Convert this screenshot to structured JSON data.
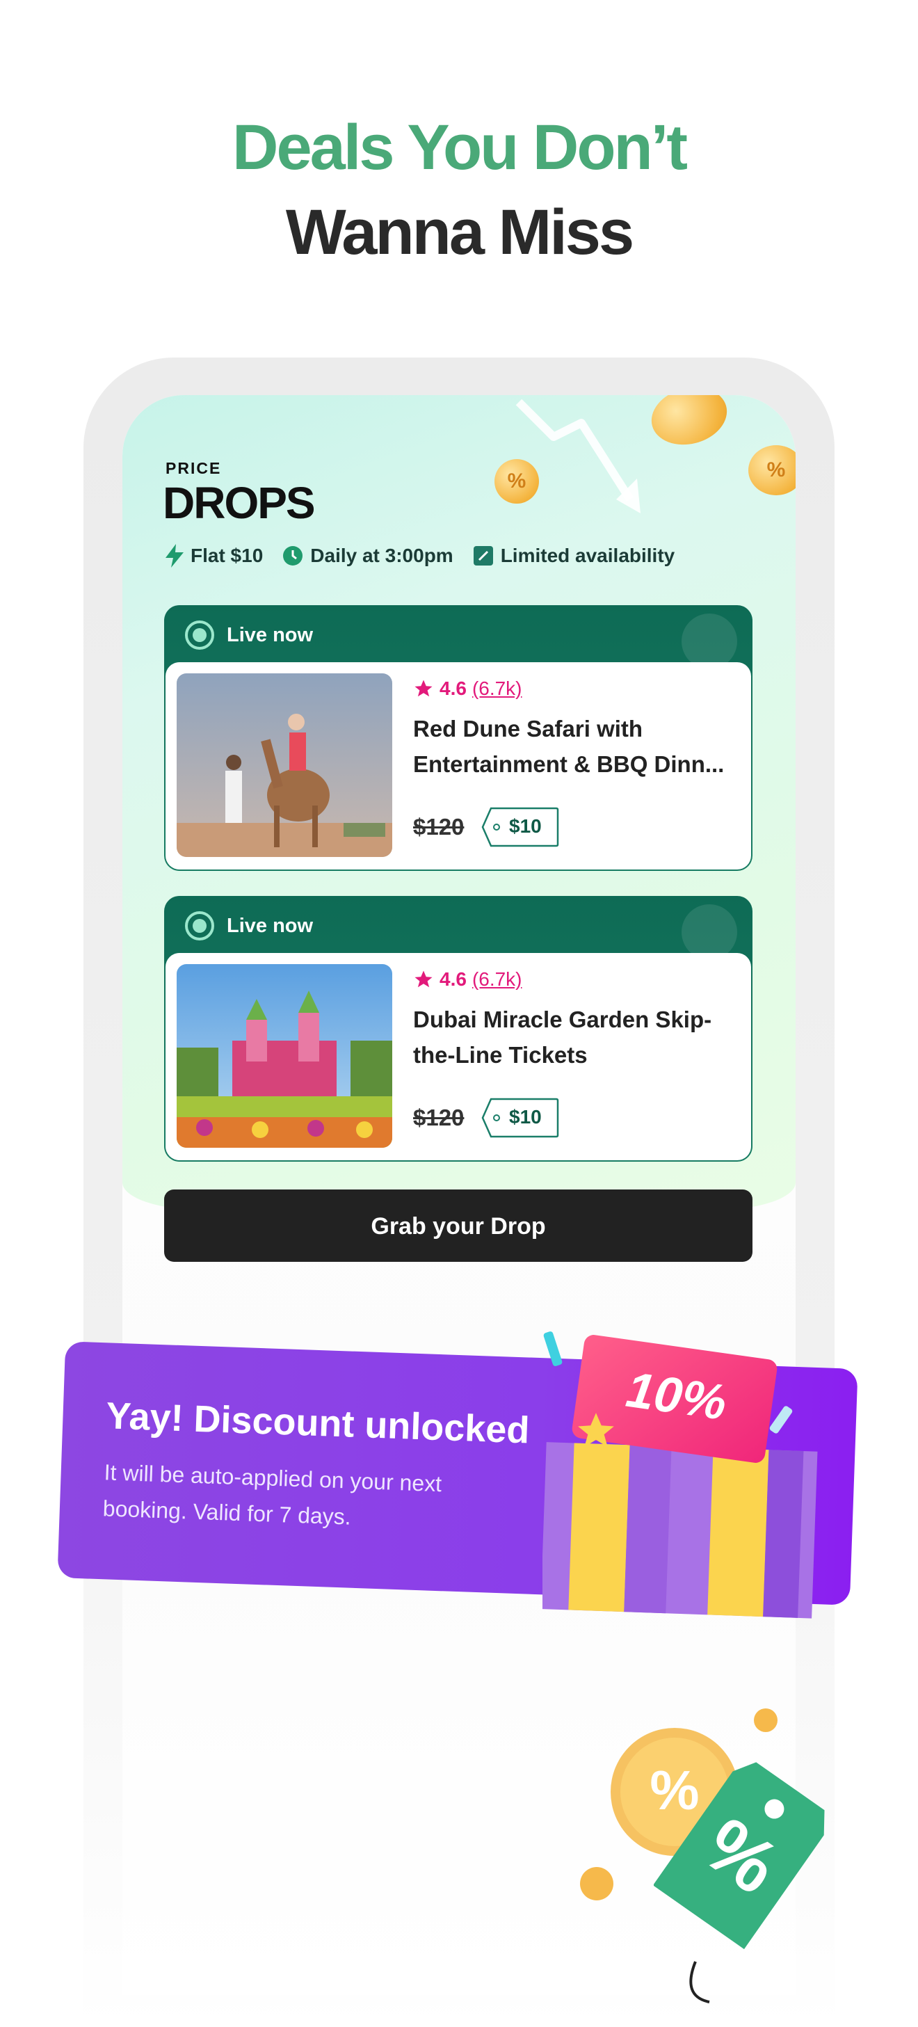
{
  "headline": {
    "line1": "Deals You Don’t",
    "line2": "Wanna Miss"
  },
  "price_drops": {
    "label_top": "PRICE",
    "label_main": "DROPS",
    "chips": [
      {
        "icon": "bolt-icon",
        "label": "Flat $10"
      },
      {
        "icon": "clock-icon",
        "label": "Daily at 3:00pm"
      },
      {
        "icon": "ticket-icon",
        "label": "Limited availability"
      }
    ]
  },
  "deals": [
    {
      "status": "Live now",
      "rating": "4.6",
      "reviews": "(6.7k)",
      "title": "Red Dune Safari with Entertainment & BBQ Dinn...",
      "old_price": "$120",
      "new_price": "$10",
      "image": "desert-camel-photo"
    },
    {
      "status": "Live now",
      "rating": "4.6",
      "reviews": "(6.7k)",
      "title": "Dubai Miracle Garden Skip-the-Line Tickets",
      "old_price": "$120",
      "new_price": "$10",
      "image": "flower-castle-photo"
    }
  ],
  "cta": {
    "label": "Grab your Drop"
  },
  "discount_banner": {
    "title": "Yay! Discount unlocked",
    "subtitle": "It will be auto-applied on your next booking. Valid for 7 days.",
    "badge": "10%"
  },
  "colors": {
    "accent_green": "#4aa978",
    "card_green": "#0e6b55",
    "rating_pink": "#e21a7b",
    "banner_purple": "#8b3eea"
  }
}
